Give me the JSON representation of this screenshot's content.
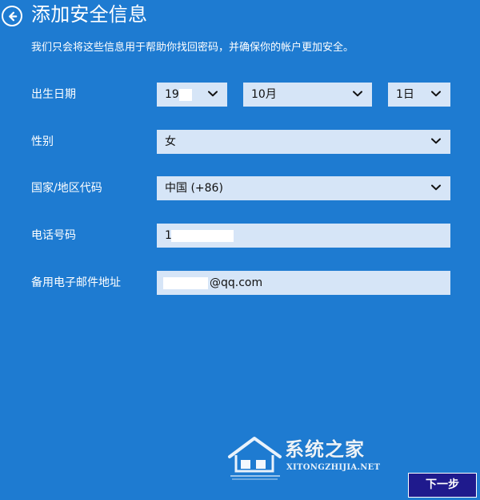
{
  "header": {
    "title": "添加安全信息",
    "back_icon": "back-arrow-icon"
  },
  "description": "我们只会将这些信息用于帮助你找回密码，并确保你的帐户更加安全。",
  "form": {
    "birth_date": {
      "label": "出生日期",
      "year_value": "19",
      "month_value": "10月",
      "day_value": "1日"
    },
    "gender": {
      "label": "性别",
      "value": "女"
    },
    "country_code": {
      "label": "国家/地区代码",
      "value": "中国 (+86)"
    },
    "phone": {
      "label": "电话号码",
      "value": "1"
    },
    "backup_email": {
      "label": "备用电子邮件地址",
      "value": "@qq.com"
    }
  },
  "actions": {
    "next_label": "下一步"
  },
  "watermark": {
    "site_name": "系统之家",
    "site_url": "XITONGZHIJIA.NET"
  },
  "icons": {
    "chevron": "chevron-down-icon"
  },
  "colors": {
    "background": "#1e7bd1",
    "field_background": "#d6e5f7",
    "next_button": "#1f1a8d",
    "text_light": "#ffffff",
    "text_dark": "#111111"
  }
}
